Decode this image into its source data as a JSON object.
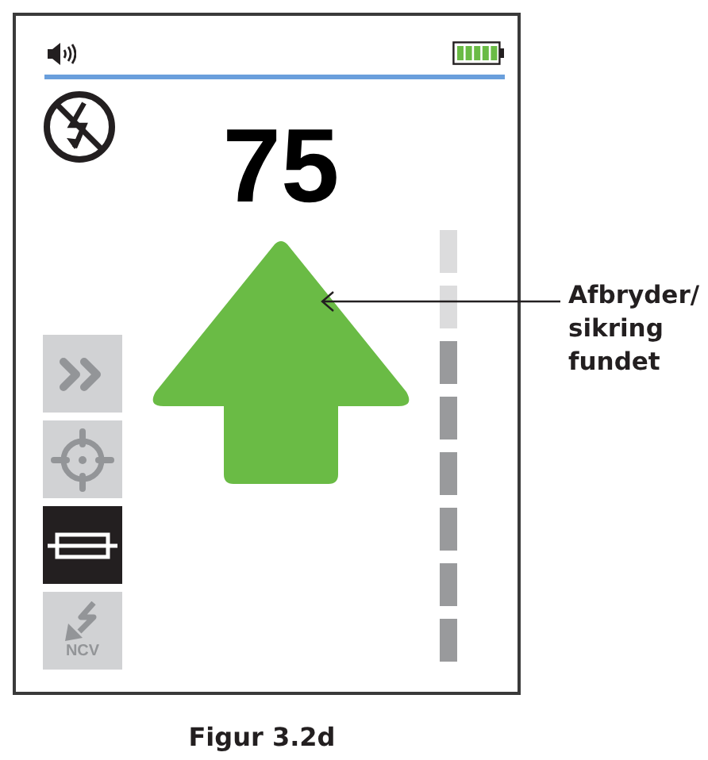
{
  "display": {
    "reading": "75"
  },
  "modes": [
    {
      "kind": "scan",
      "selected": false
    },
    {
      "kind": "target",
      "selected": false
    },
    {
      "kind": "fuse",
      "selected": true
    },
    {
      "kind": "ncv",
      "selected": false,
      "label": "NCV"
    }
  ],
  "signal_meter": {
    "level": 0.75
  },
  "callout": {
    "text": "Afbryder/\nsikring\nfundet"
  },
  "caption": "Figur 3.2d"
}
